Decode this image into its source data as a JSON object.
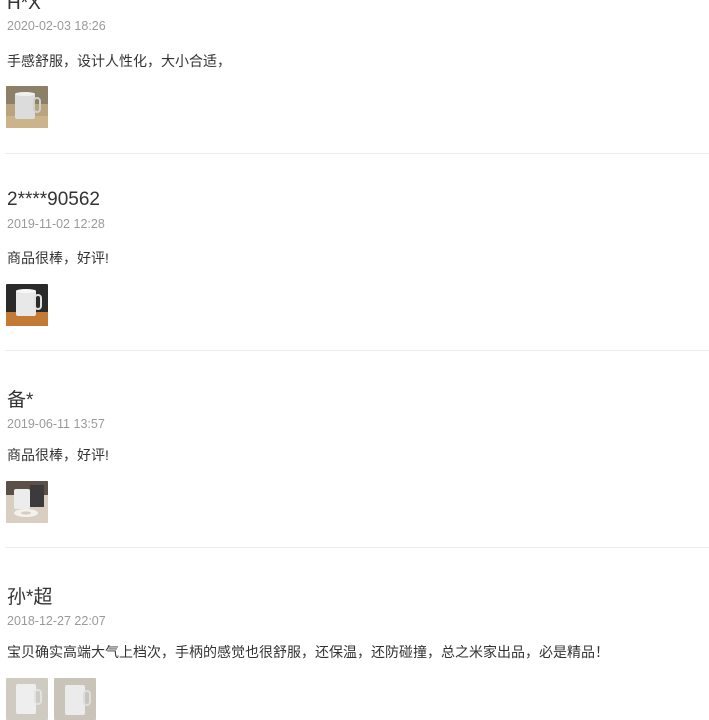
{
  "reviews": [
    {
      "user": "H*X",
      "date": "2020-02-03 18:26",
      "text": "手感舒服，设计人性化，大小合适，",
      "photos": [
        "mug-photo"
      ]
    },
    {
      "user": "2****90562",
      "date": "2019-11-02 12:28",
      "text": "商品很棒，好评!",
      "photos": [
        "mug-photo"
      ]
    },
    {
      "user": "备*",
      "date": "2019-06-11 13:57",
      "text": "商品很棒，好评!",
      "photos": [
        "mug-photo"
      ]
    },
    {
      "user": "孙*超",
      "date": "2018-12-27 22:07",
      "text": "宝贝确实高端大气上档次，手柄的感觉也很舒服，还保温，还防碰撞，总之米家出品，必是精品！",
      "photos": [
        "mug-photo",
        "mug-photo"
      ]
    }
  ]
}
